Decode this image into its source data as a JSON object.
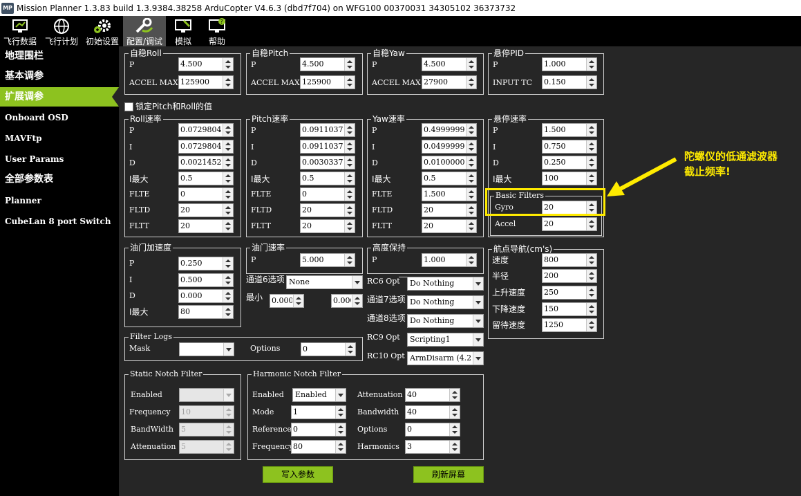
{
  "title": "Mission Planner 1.3.83 build 1.3.9384.38258 ArduCopter V4.6.3 (dbd7f704) on WFG100 00370031 34305102 36373732",
  "logo_text": "MP",
  "menu": [
    {
      "label": "飞行数据",
      "icon": "monitor-icon"
    },
    {
      "label": "飞行计划",
      "icon": "globe-icon"
    },
    {
      "label": "初始设置",
      "icon": "gear-icon"
    },
    {
      "label": "配置/调试",
      "icon": "wrench-icon"
    },
    {
      "label": "模拟",
      "icon": "simulation-icon"
    },
    {
      "label": "帮助",
      "icon": "help-icon"
    }
  ],
  "sidebar": [
    {
      "label": "地理围栏"
    },
    {
      "label": "基本调参"
    },
    {
      "label": "扩展调参",
      "active": true
    },
    {
      "label": "Onboard OSD"
    },
    {
      "label": "MAVFtp"
    },
    {
      "label": "User Params"
    },
    {
      "label": "全部参数表"
    },
    {
      "label": "Planner"
    },
    {
      "label": "CubeLan 8 port Switch"
    }
  ],
  "stab_roll": {
    "title": "自稳Roll",
    "p_label": "P",
    "p": "4.500",
    "accel_label": "ACCEL MAX",
    "accel": "125900"
  },
  "stab_pitch": {
    "title": "自稳Pitch",
    "p_label": "P",
    "p": "4.500",
    "accel_label": "ACCEL MAX",
    "accel": "125900"
  },
  "stab_yaw": {
    "title": "自稳Yaw",
    "p_label": "P",
    "p": "4.500",
    "accel_label": "ACCEL MAX",
    "accel": "27900"
  },
  "loiter_pid": {
    "title": "悬停PID",
    "p_label": "P",
    "p": "1.000",
    "tc_label": "INPUT TC",
    "tc": "0.150"
  },
  "lock_pitch_roll": "锁定Pitch和Roll的值",
  "rate_labels": {
    "p": "P",
    "i": "I",
    "d": "D",
    "imax": "I最大",
    "flte": "FLTE",
    "fltd": "FLTD",
    "fltt": "FLTT"
  },
  "roll_rate": {
    "title": "Roll速率",
    "p": "0.07298045",
    "i": "0.07298045",
    "d": "0.00214520",
    "imax": "0.5",
    "flte": "0",
    "fltd": "20",
    "fltt": "20"
  },
  "pitch_rate": {
    "title": "Pitch速率",
    "p": "0.09110379",
    "i": "0.09110379",
    "d": "0.00303377",
    "imax": "0.5",
    "flte": "0",
    "fltd": "20",
    "fltt": "20"
  },
  "yaw_rate": {
    "title": "Yaw速率",
    "p": "0.4999999",
    "i": "0.04999999",
    "d": "0.01000001",
    "imax": "0.5",
    "flte": "1.500",
    "fltd": "20",
    "fltt": "20"
  },
  "loiter_rate": {
    "title": "悬停速率",
    "p": "1.500",
    "i": "0.750",
    "d": "0.250",
    "imax": "100"
  },
  "basic_filters": {
    "title": "Basic Filters",
    "gyro_label": "Gyro",
    "gyro": "20",
    "accel_label": "Accel",
    "accel": "20"
  },
  "throttle_accel": {
    "title": "油门加速度",
    "p": "0.250",
    "i": "0.500",
    "d": "0.000",
    "imax": "80"
  },
  "throttle_rate": {
    "title": "油门速率",
    "p_label": "P",
    "p": "5.000",
    "ch6_label": "通道6选项",
    "ch6": "None",
    "min_label": "最小",
    "min": "0.000",
    "max": "0.000"
  },
  "alt_hold": {
    "title": "高度保持",
    "p_label": "P",
    "p": "1.000"
  },
  "rc_options": [
    {
      "label": "RC6 Opt",
      "value": "Do Nothing"
    },
    {
      "label": "通道7选项",
      "value": "Do Nothing"
    },
    {
      "label": "通道8选项",
      "value": "Do Nothing"
    },
    {
      "label": "RC9 Opt",
      "value": "Scripting1"
    },
    {
      "label": "RC10 Opt",
      "value": "ArmDisarm (4.2"
    }
  ],
  "waypoint_nav": {
    "title": "航点导航(cm's)",
    "speed_label": "速度",
    "speed": "800",
    "radius_label": "半径",
    "radius": "200",
    "up_label": "上升速度",
    "up": "250",
    "down_label": "下降速度",
    "down": "150",
    "loiter_label": "留待速度",
    "loiter": "1250"
  },
  "filter_logs": {
    "title": "Filter Logs",
    "mask_label": "Mask",
    "mask": "",
    "options_label": "Options",
    "options": "0"
  },
  "static_notch": {
    "title": "Static Notch Filter",
    "enabled_label": "Enabled",
    "enabled": "",
    "freq_label": "Frequency",
    "freq": "10",
    "bw_label": "BandWidth",
    "bw": "5",
    "att_label": "Attenuation",
    "att": "5"
  },
  "harmonic_notch": {
    "title": "Harmonic Notch Filter",
    "enabled_label": "Enabled",
    "enabled": "Enabled",
    "mode_label": "Mode",
    "mode": "1",
    "ref_label": "Reference",
    "ref": "0",
    "freq_label": "Frequency",
    "freq": "80",
    "att_label": "Attenuation",
    "att": "40",
    "bw_label": "Bandwidth",
    "bw": "40",
    "opt_label": "Options",
    "opt": "0",
    "harm_label": "Harmonics",
    "harm": "3"
  },
  "buttons": {
    "write": "写入参数",
    "refresh": "刷新屏幕"
  },
  "annotation": {
    "line1": "陀螺仪的低通滤波器",
    "line2": "截止频率!",
    "color": "#ffeb00"
  },
  "colors": {
    "accent": "#8dc21f",
    "highlight": "#ffeb00",
    "background": "#262626"
  }
}
